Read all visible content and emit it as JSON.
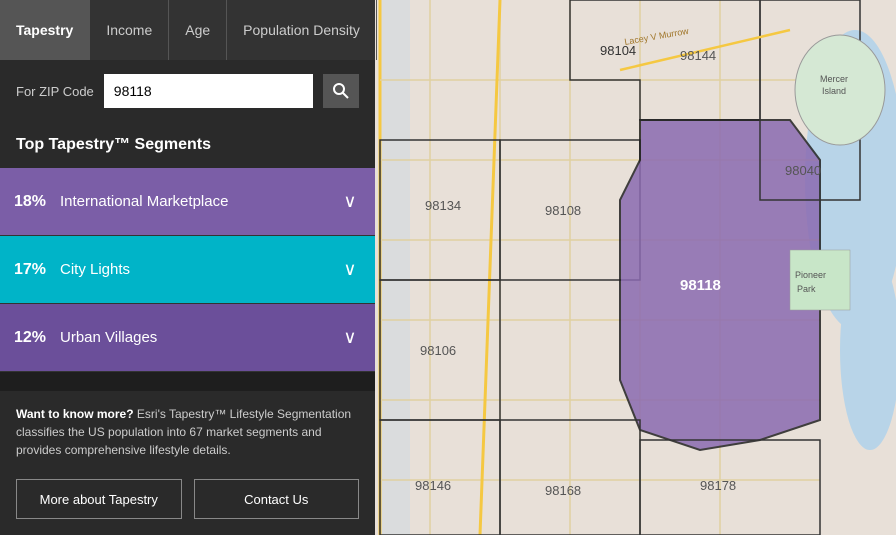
{
  "tabs": [
    {
      "id": "tapestry",
      "label": "Tapestry",
      "active": true
    },
    {
      "id": "income",
      "label": "Income",
      "active": false
    },
    {
      "id": "age",
      "label": "Age",
      "active": false
    },
    {
      "id": "population-density",
      "label": "Population Density",
      "active": false
    }
  ],
  "search": {
    "label": "For ZIP Code",
    "value": "98118",
    "placeholder": "ZIP Code"
  },
  "segments_header": "Top Tapestry™ Segments",
  "segments": [
    {
      "id": "international-marketplace",
      "pct": "18%",
      "name": "International Marketplace",
      "style": "purple"
    },
    {
      "id": "city-lights",
      "pct": "17%",
      "name": "City Lights",
      "style": "cyan"
    },
    {
      "id": "urban-villages",
      "pct": "12%",
      "name": "Urban Villages",
      "style": "purple-dark"
    }
  ],
  "info": {
    "bold": "Want to know more?",
    "text": " Esri's Tapestry™ Lifestyle Segmentation classifies the US population into 67 market segments and provides comprehensive lifestyle details."
  },
  "buttons": [
    {
      "id": "more-about-tapestry",
      "label": "More about Tapestry"
    },
    {
      "id": "contact-us",
      "label": "Contact Us"
    }
  ],
  "map": {
    "zip_labels": [
      "98104",
      "98144",
      "98134",
      "98108",
      "98106",
      "98118",
      "98040",
      "98146",
      "98168",
      "98178"
    ],
    "accent_color": "#8b6bb1",
    "road_color": "#f5c842",
    "water_color": "#b8d4e8"
  }
}
